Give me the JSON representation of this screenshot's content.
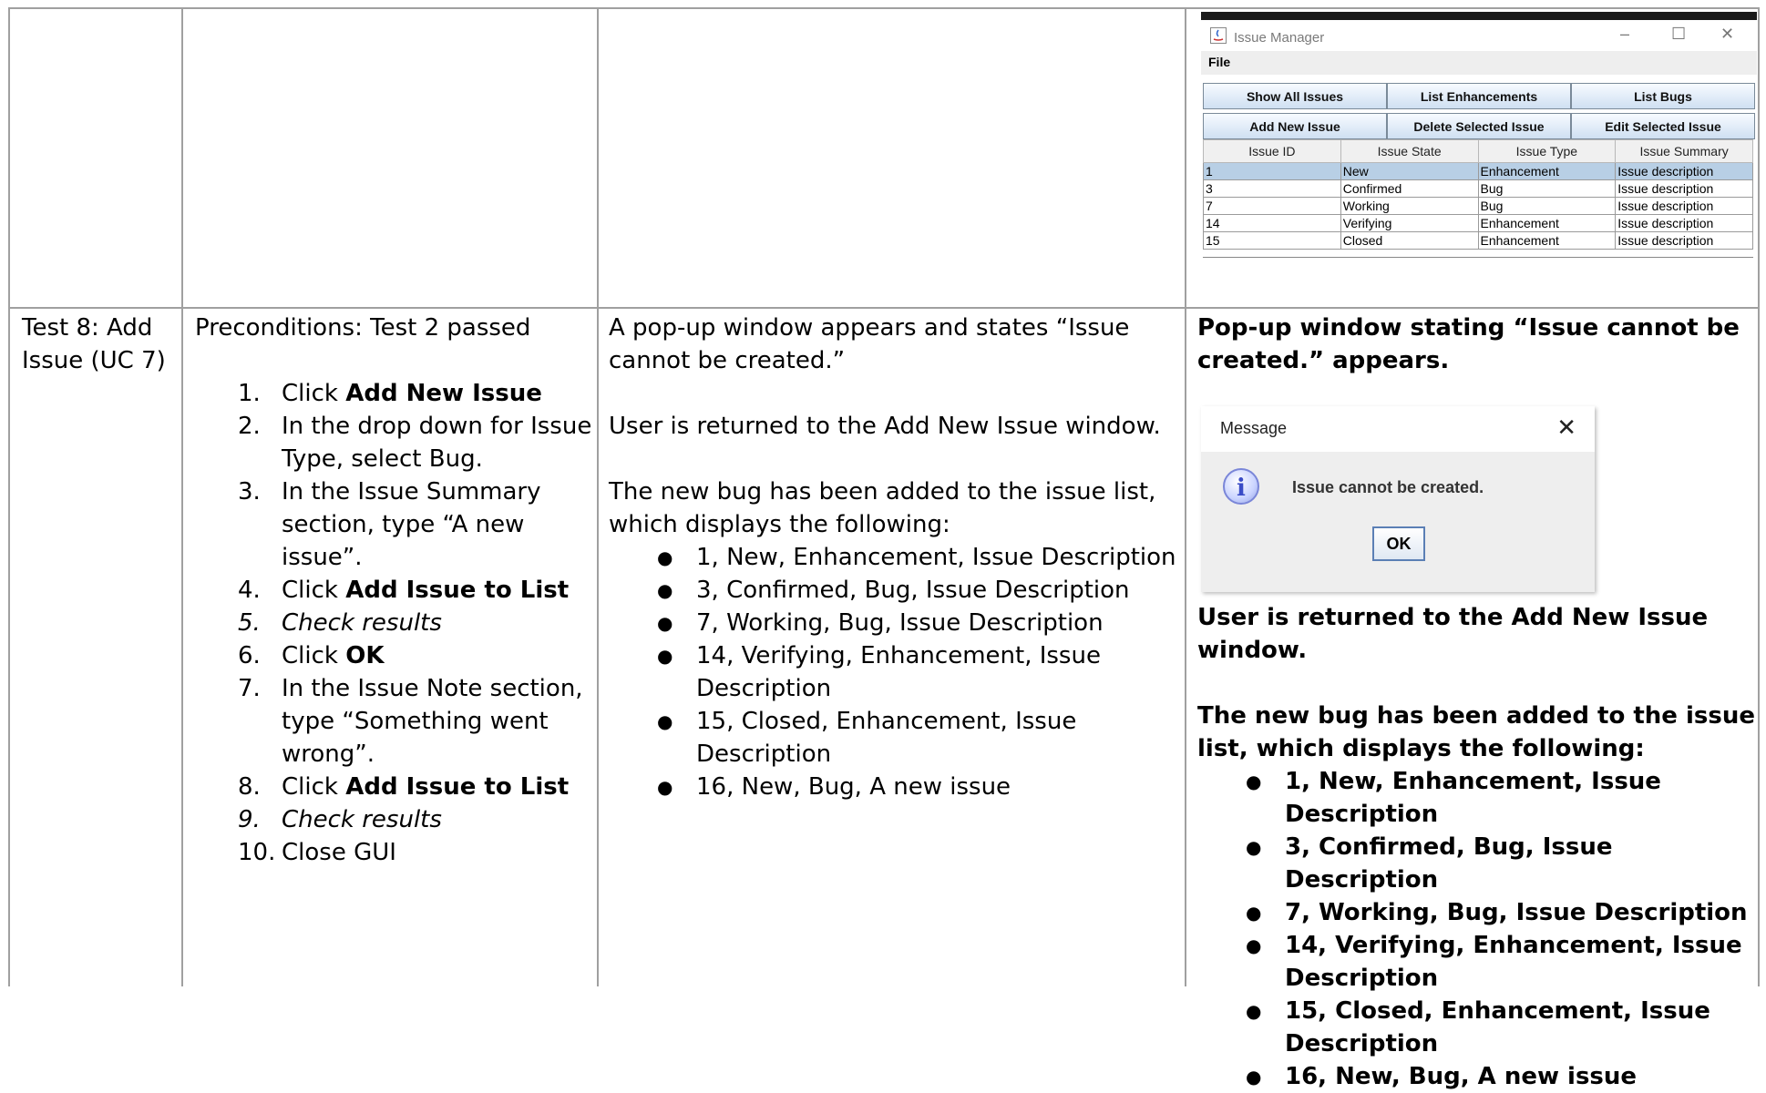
{
  "screenshot_window": {
    "title": "Issue Manager",
    "menu_file": "File",
    "buttons": [
      "Show All Issues",
      "List Enhancements",
      "List Bugs",
      "Add New Issue",
      "Delete Selected Issue",
      "Edit Selected Issue"
    ],
    "table": {
      "columns": [
        "Issue ID",
        "Issue State",
        "Issue Type",
        "Issue Summary"
      ],
      "rows": [
        [
          "1",
          "New",
          "Enhancement",
          "Issue description"
        ],
        [
          "3",
          "Confirmed",
          "Bug",
          "Issue description"
        ],
        [
          "7",
          "Working",
          "Bug",
          "Issue description"
        ],
        [
          "14",
          "Verifying",
          "Enhancement",
          "Issue description"
        ],
        [
          "15",
          "Closed",
          "Enhancement",
          "Issue description"
        ]
      ]
    }
  },
  "test": {
    "name": "Test 8: Add Issue (UC 7)",
    "preconditions": "Preconditions: Test 2 passed",
    "steps": [
      {
        "num": "1.",
        "pre": "Click ",
        "bold": "Add New Issue"
      },
      {
        "num": "2.",
        "text": "In the drop down for Issue Type, select Bug."
      },
      {
        "num": "3.",
        "text": "In the Issue Summary section, type “A new issue”."
      },
      {
        "num": "4.",
        "pre": "Click ",
        "bold": "Add Issue to List"
      },
      {
        "num": "5.",
        "italic": "Check results"
      },
      {
        "num": "6.",
        "pre": "Click ",
        "bold": "OK"
      },
      {
        "num": "7.",
        "text": "In the Issue Note section, type “Something went wrong”."
      },
      {
        "num": "8.",
        "pre": "Click ",
        "bold": "Add Issue to List"
      },
      {
        "num": "9.",
        "italic": "Check results"
      },
      {
        "num": "10.",
        "text": "Close GUI"
      }
    ],
    "expected": {
      "line1": "A pop-up window appears and  states “Issue cannot be created.”",
      "line2": "User is returned to the Add New Issue window.",
      "line3": "The new bug has been added to the issue list, which displays the following:",
      "bullets": [
        "1, New, Enhancement, Issue Description",
        "3, Confirmed, Bug, Issue Description",
        "7, Working, Bug, Issue Description",
        "14, Verifying, Enhancement, Issue Description",
        "15, Closed, Enhancement, Issue Description",
        "16, New, Bug, A new issue"
      ]
    },
    "actual": {
      "line1": "Pop-up window stating “Issue cannot be created.” appears.",
      "line2": "User is returned to the Add New Issue window.",
      "line3": "The new bug has been added to the issue list, which displays the following:",
      "bullets": [
        "1, New, Enhancement, Issue Description",
        "3, Confirmed, Bug, Issue Description",
        "7, Working, Bug, Issue Description",
        "14, Verifying, Enhancement, Issue Description",
        "15, Closed, Enhancement, Issue Description",
        "16, New, Bug, A new issue"
      ]
    }
  },
  "dialog": {
    "title": "Message",
    "close_glyph": "✕",
    "icon_glyph": "i",
    "message": "Issue cannot be created.",
    "ok_label": "OK"
  }
}
